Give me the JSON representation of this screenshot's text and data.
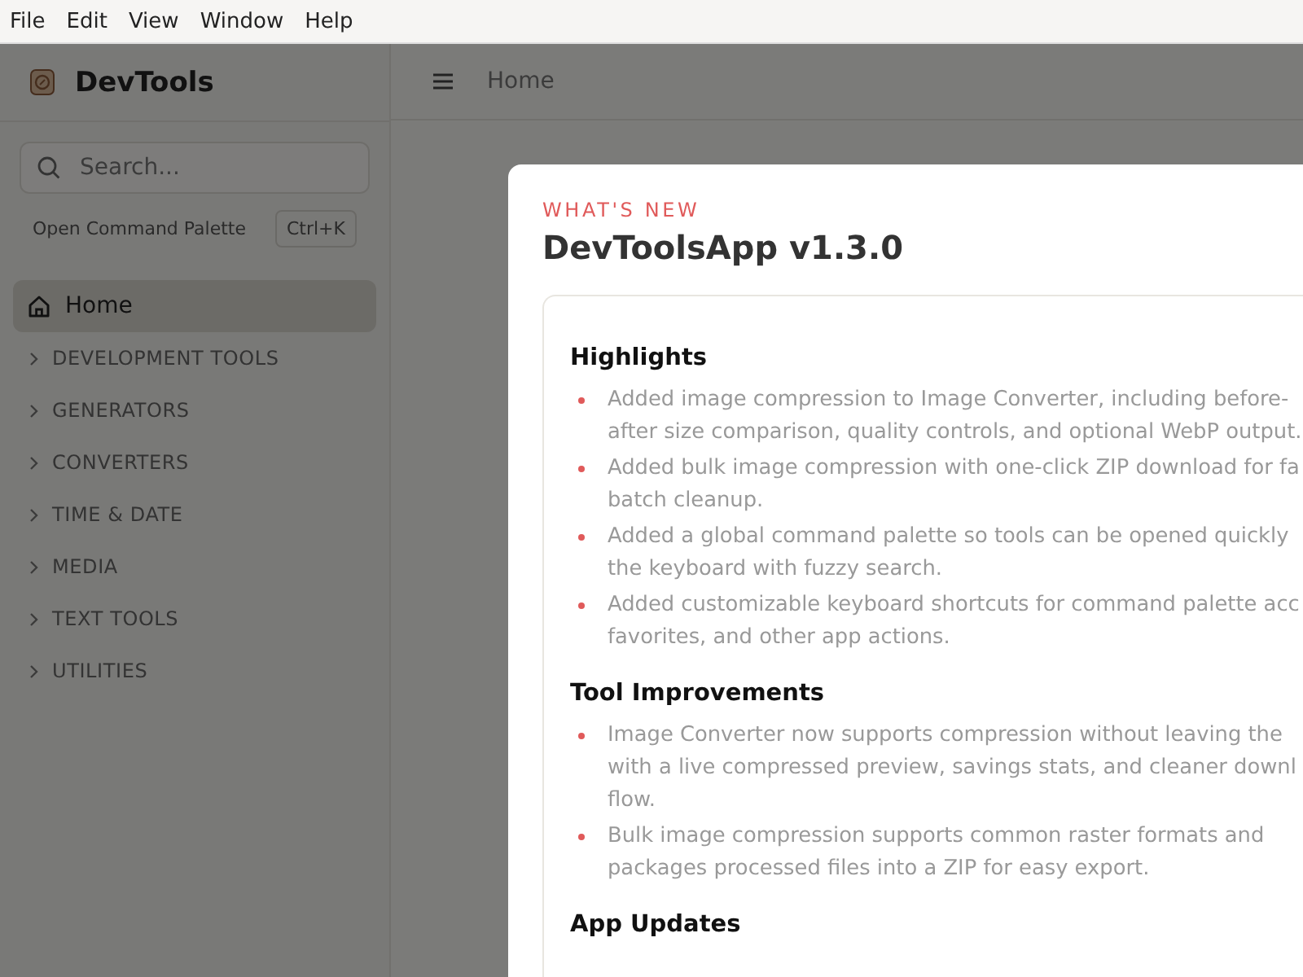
{
  "menu_bar": [
    "File",
    "Edit",
    "View",
    "Window",
    "Help"
  ],
  "sidebar": {
    "app_name": "DevTools",
    "search": {
      "placeholder": "Search..."
    },
    "command_palette": {
      "label": "Open Command Palette",
      "shortcut": "Ctrl+K"
    },
    "home": {
      "label": "Home",
      "selected": true
    },
    "categories": [
      {
        "label": "DEVELOPMENT TOOLS",
        "expanded": false
      },
      {
        "label": "GENERATORS",
        "expanded": false
      },
      {
        "label": "CONVERTERS",
        "expanded": false
      },
      {
        "label": "TIME & DATE",
        "expanded": false
      },
      {
        "label": "MEDIA",
        "expanded": false
      },
      {
        "label": "TEXT TOOLS",
        "expanded": false
      },
      {
        "label": "UTILITIES",
        "expanded": false
      }
    ]
  },
  "header": {
    "breadcrumb": "Home"
  },
  "modal": {
    "eyebrow": "WHAT'S NEW",
    "title": "DevToolsApp v1.3.0",
    "sections": [
      {
        "heading": "Highlights",
        "items": [
          {
            "lines": [
              "Added image compression to Image Converter, including before-",
              "after size comparison, quality controls, and optional WebP output."
            ]
          },
          {
            "lines": [
              "Added bulk image compression with one-click ZIP download for fa",
              "batch cleanup."
            ]
          },
          {
            "lines": [
              "Added a global command palette so tools can be opened quickly",
              "the keyboard with fuzzy search."
            ]
          },
          {
            "lines": [
              "Added customizable keyboard shortcuts for command palette acc",
              "favorites, and other app actions."
            ]
          }
        ]
      },
      {
        "heading": "Tool Improvements",
        "items": [
          {
            "lines": [
              "Image Converter now supports compression without leaving the",
              "with a live compressed preview, savings stats, and cleaner downl",
              "flow."
            ]
          },
          {
            "lines": [
              "Bulk image compression supports common raster formats and",
              "packages processed files into a ZIP for easy export."
            ]
          }
        ]
      },
      {
        "heading": "App Updates"
      }
    ]
  }
}
